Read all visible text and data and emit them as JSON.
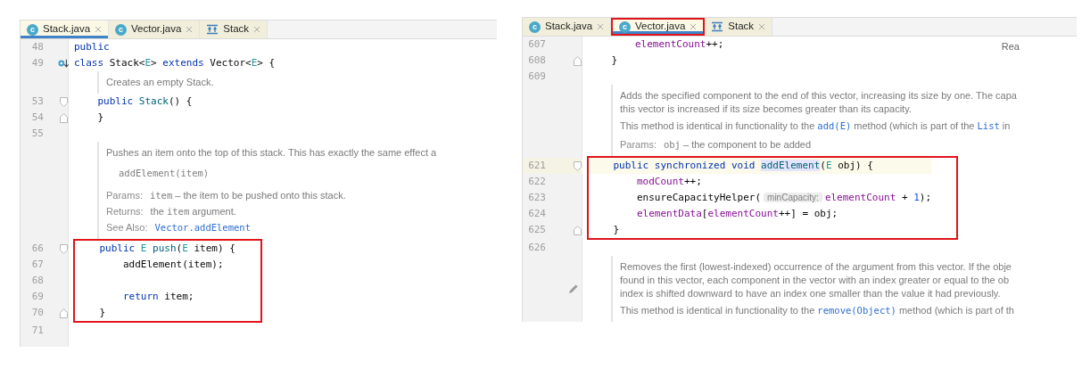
{
  "editors": [
    {
      "tabs": [
        {
          "label": "Stack.java",
          "kind": "class",
          "icon_letter": "c",
          "selected": true,
          "boxed": false
        },
        {
          "label": "Vector.java",
          "kind": "class",
          "icon_letter": "c",
          "selected": false,
          "boxed": false
        },
        {
          "label": "Stack",
          "kind": "structure",
          "selected": false,
          "boxed": false
        }
      ],
      "rows": [
        {
          "kind": "code",
          "number": "48",
          "tokens": [
            {
              "text": "public",
              "kind": "keyword"
            }
          ]
        },
        {
          "kind": "code",
          "number": "49",
          "gutter": {
            "kind": "implements"
          },
          "tokens": [
            {
              "text": "class",
              "kind": "keyword"
            },
            {
              "text": " Stack<",
              "kind": "plain"
            },
            {
              "text": "E",
              "kind": "type"
            },
            {
              "text": "> ",
              "kind": "plain"
            },
            {
              "text": "extends",
              "kind": "keyword"
            },
            {
              "text": " Vector<",
              "kind": "plain"
            },
            {
              "text": "E",
              "kind": "type"
            },
            {
              "text": "> {",
              "kind": "plain"
            }
          ]
        },
        {
          "kind": "doc",
          "paragraphs": [
            {
              "kind": "text",
              "lines": [
                [
                  {
                    "text": "Creates an empty Stack.",
                    "kind": "plain"
                  }
                ]
              ]
            }
          ]
        },
        {
          "kind": "code",
          "number": "53",
          "gutter": {
            "kind": "fold-start"
          },
          "tokens": [
            {
              "text": "    public",
              "kind": "keyword"
            },
            {
              "text": " Stack",
              "kind": "method"
            },
            {
              "text": "() {",
              "kind": "plain"
            }
          ]
        },
        {
          "kind": "code",
          "number": "54",
          "gutter": {
            "kind": "fold-end"
          },
          "tokens": [
            {
              "text": "    }",
              "kind": "plain"
            }
          ]
        },
        {
          "kind": "code",
          "number": "55",
          "tokens": []
        },
        {
          "kind": "doc",
          "paragraphs": [
            {
              "kind": "text",
              "lines": [
                [
                  {
                    "text": "Pushes an item onto the top of this stack. This has exactly the same effect a",
                    "kind": "plain"
                  }
                ]
              ]
            },
            {
              "kind": "code",
              "lines": [
                [
                  {
                    "text": "addElement(item)",
                    "kind": "mono"
                  }
                ]
              ]
            },
            {
              "kind": "fields",
              "lines": [
                [
                  {
                    "text": "Params:",
                    "kind": "label"
                  },
                  {
                    "text": "item",
                    "kind": "mono"
                  },
                  {
                    "text": " – the item to be pushed onto this stack.",
                    "kind": "plain"
                  }
                ],
                [
                  {
                    "text": "Returns:",
                    "kind": "label"
                  },
                  {
                    "text": "the ",
                    "kind": "plain"
                  },
                  {
                    "text": "item",
                    "kind": "mono"
                  },
                  {
                    "text": " argument.",
                    "kind": "plain"
                  }
                ],
                [
                  {
                    "text": "See Also:",
                    "kind": "label"
                  },
                  {
                    "text": "Vector.addElement",
                    "kind": "link"
                  }
                ]
              ]
            }
          ]
        },
        {
          "kind": "boxed",
          "rows": [
            {
              "kind": "code",
              "number": "66",
              "gutter": {
                "kind": "fold-start"
              },
              "tokens": [
                {
                  "text": "    public",
                  "kind": "keyword"
                },
                {
                  "text": " E",
                  "kind": "type"
                },
                {
                  "text": " push",
                  "kind": "method"
                },
                {
                  "text": "(",
                  "kind": "plain"
                },
                {
                  "text": "E",
                  "kind": "type"
                },
                {
                  "text": " item) {",
                  "kind": "plain"
                }
              ]
            },
            {
              "kind": "code",
              "number": "67",
              "tokens": [
                {
                  "text": "        addElement(item);",
                  "kind": "plain"
                }
              ]
            },
            {
              "kind": "code",
              "number": "68",
              "tokens": []
            },
            {
              "kind": "code",
              "number": "69",
              "tokens": [
                {
                  "text": "        return",
                  "kind": "keyword"
                },
                {
                  "text": " item;",
                  "kind": "plain"
                }
              ]
            },
            {
              "kind": "code",
              "number": "70",
              "gutter": {
                "kind": "fold-end"
              },
              "tokens": [
                {
                  "text": "    }",
                  "kind": "plain"
                }
              ]
            }
          ]
        },
        {
          "kind": "code",
          "number": "71",
          "tokens": []
        }
      ]
    },
    {
      "tabs": [
        {
          "label": "Stack.java",
          "kind": "class",
          "icon_letter": "c",
          "selected": false,
          "boxed": false
        },
        {
          "label": "Vector.java",
          "kind": "class",
          "icon_letter": "c",
          "selected": true,
          "boxed": true
        },
        {
          "label": "Stack",
          "kind": "structure",
          "selected": false,
          "boxed": false
        }
      ],
      "corner_label": "Rea",
      "rows": [
        {
          "kind": "code",
          "number": "607",
          "tokens": [
            {
              "text": "        elementCount",
              "kind": "field"
            },
            {
              "text": "++;",
              "kind": "plain"
            }
          ]
        },
        {
          "kind": "code",
          "number": "608",
          "gutter": {
            "kind": "fold-end"
          },
          "tokens": [
            {
              "text": "    }",
              "kind": "plain"
            }
          ]
        },
        {
          "kind": "code",
          "number": "609",
          "tokens": []
        },
        {
          "kind": "doc",
          "paragraphs": [
            {
              "kind": "text",
              "lines": [
                [
                  {
                    "text": "Adds the specified component to the end of this vector, increasing its size by one. The capa",
                    "kind": "plain"
                  }
                ],
                [
                  {
                    "text": "this vector is increased if its size becomes greater than its capacity.",
                    "kind": "plain"
                  }
                ]
              ]
            },
            {
              "kind": "text",
              "lines": [
                [
                  {
                    "text": "This method is identical in functionality to the ",
                    "kind": "plain"
                  },
                  {
                    "text": "add(E)",
                    "kind": "link"
                  },
                  {
                    "text": " method (which is part of the ",
                    "kind": "plain"
                  },
                  {
                    "text": "List",
                    "kind": "link"
                  },
                  {
                    "text": " in",
                    "kind": "plain"
                  }
                ]
              ]
            },
            {
              "kind": "fields",
              "lines": [
                [
                  {
                    "text": "Params:",
                    "kind": "label"
                  },
                  {
                    "text": "obj",
                    "kind": "mono"
                  },
                  {
                    "text": " – the component to be added",
                    "kind": "plain"
                  }
                ]
              ]
            }
          ]
        },
        {
          "kind": "boxed",
          "rows": [
            {
              "kind": "code",
              "number": "621",
              "gutter": {
                "kind": "fold-start"
              },
              "current": true,
              "tokens": [
                {
                  "text": "    public",
                  "kind": "keyword"
                },
                {
                  "text": " synchronized",
                  "kind": "keyword"
                },
                {
                  "text": " void ",
                  "kind": "keyword"
                },
                {
                  "text": "addElement",
                  "kind": "usage"
                },
                {
                  "text": "(",
                  "kind": "plain"
                },
                {
                  "text": "E",
                  "kind": "type"
                },
                {
                  "text": " obj) {",
                  "kind": "plain"
                }
              ]
            },
            {
              "kind": "code",
              "number": "622",
              "tokens": [
                {
                  "text": "        modCount",
                  "kind": "field"
                },
                {
                  "text": "++;",
                  "kind": "plain"
                }
              ]
            },
            {
              "kind": "code",
              "number": "623",
              "tokens": [
                {
                  "text": "        ensureCapacityHelper(",
                  "kind": "plain"
                },
                {
                  "text": "minCapacity:",
                  "kind": "hint"
                },
                {
                  "text": "elementCount",
                  "kind": "field"
                },
                {
                  "text": " + ",
                  "kind": "plain"
                },
                {
                  "text": "1",
                  "kind": "number"
                },
                {
                  "text": ");",
                  "kind": "plain"
                }
              ]
            },
            {
              "kind": "code",
              "number": "624",
              "tokens": [
                {
                  "text": "        elementData",
                  "kind": "field"
                },
                {
                  "text": "[",
                  "kind": "plain"
                },
                {
                  "text": "elementCount",
                  "kind": "field"
                },
                {
                  "text": "++] = obj;",
                  "kind": "plain"
                }
              ]
            },
            {
              "kind": "code",
              "number": "625",
              "gutter": {
                "kind": "fold-end"
              },
              "tokens": [
                {
                  "text": "    }",
                  "kind": "plain"
                }
              ]
            }
          ]
        },
        {
          "kind": "code",
          "number": "626",
          "tokens": []
        },
        {
          "kind": "doc",
          "gutter": {
            "kind": "edit"
          },
          "paragraphs": [
            {
              "kind": "text",
              "lines": [
                [
                  {
                    "text": "Removes the first (lowest-indexed) occurrence of the argument from this vector. If the obje",
                    "kind": "plain"
                  }
                ],
                [
                  {
                    "text": "found in this vector, each component in the vector with an index greater or equal to the ob",
                    "kind": "plain"
                  }
                ],
                [
                  {
                    "text": "index is shifted downward to have an index one smaller than the value it had previously.",
                    "kind": "plain"
                  }
                ]
              ]
            },
            {
              "kind": "text",
              "lines": [
                [
                  {
                    "text": "This method is identical in functionality to the ",
                    "kind": "plain"
                  },
                  {
                    "text": "remove(Object)",
                    "kind": "link"
                  },
                  {
                    "text": " method (which is part of th",
                    "kind": "plain"
                  }
                ]
              ]
            }
          ]
        }
      ]
    }
  ]
}
